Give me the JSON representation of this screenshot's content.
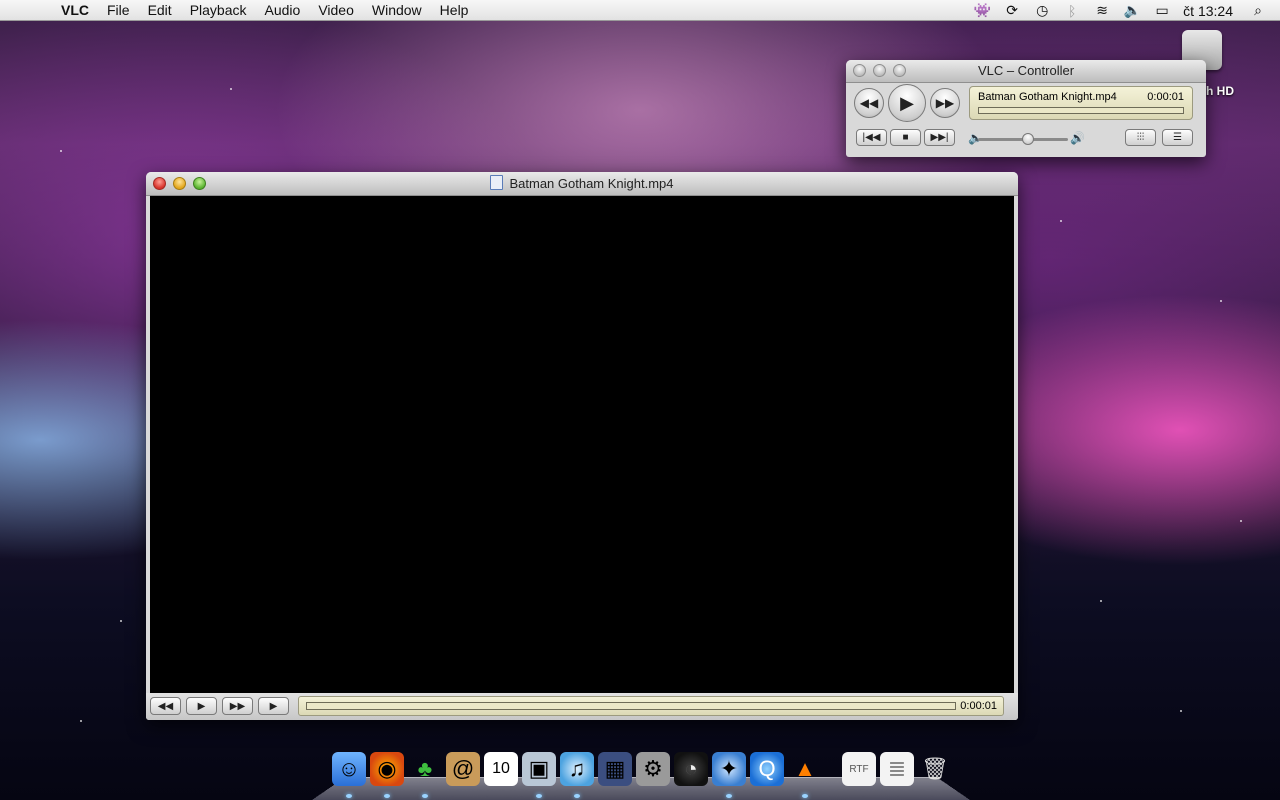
{
  "menubar": {
    "app_name": "VLC",
    "items": [
      "File",
      "Edit",
      "Playback",
      "Audio",
      "Video",
      "Window",
      "Help"
    ],
    "clock": "čt 13:24"
  },
  "desktop": {
    "hd_label": "osh HD"
  },
  "controller": {
    "title": "VLC – Controller",
    "filename": "Batman Gotham Knight.mp4",
    "time": "0:00:01"
  },
  "video_window": {
    "title": "Batman Gotham Knight.mp4",
    "time": "0:00:01"
  },
  "icons": {
    "apple": "apple-icon",
    "dock": [
      "finder-icon",
      "firefox-icon",
      "adium-icon",
      "address-book-icon",
      "ical-icon",
      "iphoto-icon",
      "itunes-icon",
      "spaces-icon",
      "system-preferences-icon",
      "dashboard-icon",
      "safari-icon",
      "quicktime-icon",
      "vlc-icon",
      "rtf-document-icon",
      "document-icon",
      "trash-icon"
    ]
  }
}
